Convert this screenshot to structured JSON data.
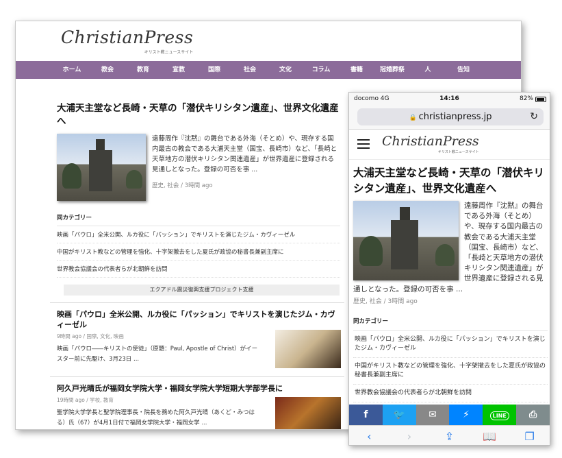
{
  "desktop": {
    "logo": {
      "name": "ChristianPress",
      "tagline": "キリスト教ニュースサイト"
    },
    "nav": [
      "ホーム",
      "教会",
      "教育",
      "宣教",
      "国際",
      "社会",
      "文化",
      "コラム",
      "書籍",
      "冠婚葬祭",
      "人",
      "告知"
    ],
    "lead": {
      "title": "大浦天主堂など長崎・天草の「潜伏キリシタン遺産」、世界文化遺産へ",
      "excerpt": "遠藤周作『沈黙』の舞台である外海（そとめ）や、現存する国内最古の教会である大浦天主堂（国宝、長崎市）など、「長崎と天草地方の潜伏キリシタン関連遺産」が世界遺産に登録される見通しとなった。登録の可否を事 ...",
      "meta": "歴史, 社会 / 3時間 ago"
    },
    "related": {
      "heading": "同カテゴリー",
      "items": [
        "映画「パウロ」全米公開、ルカ役に「パッション」でキリストを演じたジム・カヴィーゼル",
        "中国がキリスト教などの管理を強化、十字架撤去をした夏氏が政協の秘書長兼副主席に",
        "世界教会協議会の代表者らが北朝鮮を訪問"
      ]
    },
    "banner": "エクアドル震災復興支援プロジェクト支援",
    "articles": [
      {
        "title": "映画「パウロ」全米公開、ルカ役に「パッション」でキリストを演じたジム・カヴィーゼル",
        "meta": "9時間 ago / 国際, 文化, 映画",
        "excerpt": "映画「パウロ――キリストの使徒」（原題：Paul, Apostle of Christ）がイースター前に先駆け、3月23日 ..."
      },
      {
        "title": "阿久戸光晴氏が福岡女学院大学・福岡女学院大学短期大学部学長に",
        "meta": "19時間 ago / 学校, 教育",
        "excerpt": "聖学院大学学長と聖学院理事長・院長を務めた阿久戸光晴（あくど・みつはる）氏（67）が4月1日付で福岡女学院大学・福岡女学 ..."
      }
    ]
  },
  "phone": {
    "status": {
      "carrier": "docomo 4G",
      "time": "14:16",
      "battery": "82%"
    },
    "url": "christianpress.jp",
    "logo": {
      "name": "ChristianPress",
      "tagline": "キリスト教ニュースサイト"
    },
    "lead": {
      "title": "大浦天主堂など長崎・天草の「潜伏キリシタン遺産」、世界文化遺産へ",
      "excerpt": "遠藤周作『沈黙』の舞台である外海（そとめ）や、現存する国内最古の教会である大浦天主堂（国宝、長崎市）など、「長崎と天草地方の潜伏キリシタン関連遺産」が世界遺産に登録される見通しとなった。登録の可否を事 ...",
      "meta": "歴史, 社会 / 3時間 ago"
    },
    "related": {
      "heading": "同カテゴリー",
      "items": [
        "映画「パウロ」全米公開、ルカ役に「パッション」でキリストを演じたジム・カヴィーゼル",
        "中国がキリスト教などの管理を強化、十字架撤去をした夏氏が政協の秘書長兼副主席に",
        "世界教会協議会の代表者らが北朝鮮を訪問"
      ]
    },
    "share": [
      {
        "icon": "facebook-icon",
        "glyph": "f",
        "color": "#3b5998"
      },
      {
        "icon": "twitter-icon",
        "glyph": "🐦",
        "color": "#1da1f2"
      },
      {
        "icon": "mail-icon",
        "glyph": "✉",
        "color": "#888888"
      },
      {
        "icon": "messenger-icon",
        "glyph": "⚡",
        "color": "#0084ff"
      },
      {
        "icon": "line-icon",
        "glyph": "LINE",
        "color": "#00c300"
      },
      {
        "icon": "print-icon",
        "glyph": "⎙",
        "color": "#7f8c8d"
      }
    ],
    "toolbar": [
      {
        "icon": "back-icon",
        "glyph": "‹",
        "enabled": true
      },
      {
        "icon": "forward-icon",
        "glyph": "›",
        "enabled": false
      },
      {
        "icon": "share-icon",
        "glyph": "⇪",
        "enabled": true
      },
      {
        "icon": "bookmarks-icon",
        "glyph": "📖",
        "enabled": true
      },
      {
        "icon": "tabs-icon",
        "glyph": "❐",
        "enabled": true
      }
    ]
  }
}
